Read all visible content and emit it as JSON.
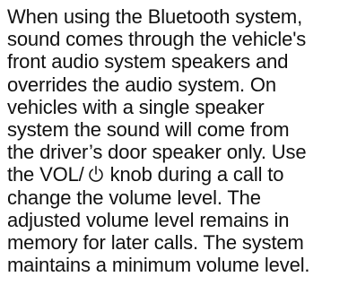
{
  "document": {
    "paragraph": {
      "line_01": "When using the Bluetooth system,",
      "line_02": "sound comes through the vehicle's",
      "line_03": "front audio system speakers and",
      "line_04": "overrides the audio system. On",
      "line_05": "vehicles with a single speaker",
      "line_06": "system the sound will come from",
      "line_07": "the driver’s door speaker only. Use",
      "line_08_before_icon": "the VOL/",
      "line_08_after_icon": " knob during a call to",
      "line_09": "change the volume level. The",
      "line_10": "adjusted volume level remains in",
      "line_11": "memory for later calls. The system",
      "line_12": "maintains a minimum volume level."
    },
    "inline_icon": "power-icon"
  }
}
